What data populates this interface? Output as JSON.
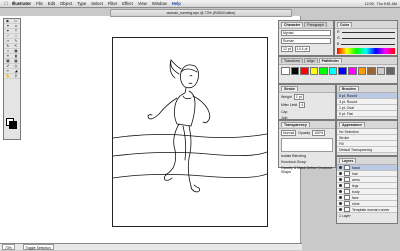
{
  "menubar": {
    "items": [
      "Illustrator",
      "File",
      "Edit",
      "Object",
      "Type",
      "Select",
      "Filter",
      "Effect",
      "View",
      "Window",
      "Help"
    ],
    "right": [
      "12:09",
      "Thu 9:51 AM"
    ]
  },
  "document": {
    "title": "woman_running.eps @ 73% (RGB/Outline)"
  },
  "status": {
    "zoom": "73%",
    "mode": "Toggle Selection"
  },
  "panels": {
    "character": {
      "tabs": [
        "Character",
        "Paragraph",
        "OpenType"
      ],
      "font": "Myriad",
      "style": "Roman",
      "size": "12 pt",
      "leading": "14.4 pt"
    },
    "color": {
      "tabs": [
        "Color"
      ],
      "labels": [
        "R",
        "G",
        "B"
      ]
    },
    "swatches": {
      "tabs": [
        "Transform",
        "Align",
        "Pathfinder"
      ],
      "colors": [
        "#ffffff",
        "#000000",
        "#ff0000",
        "#ffff00",
        "#00ff00",
        "#00ffff",
        "#0000ff",
        "#ff00ff",
        "#ff9900",
        "#996633",
        "#cccccc",
        "#666666"
      ]
    },
    "stroke": {
      "tabs": [
        "Stroke"
      ],
      "labels": [
        "Weight",
        "Miter Limit",
        "Cap",
        "Join"
      ],
      "weight": "1 pt",
      "miter": "4"
    },
    "brushes": {
      "tabs": [
        "Brushes"
      ],
      "items": [
        "5 pt. Round",
        "3 pt. Round",
        "1 pt. Oval",
        "5 pt. Flat"
      ]
    },
    "transparency": {
      "tabs": [
        "Transparency"
      ],
      "mode": "Normal",
      "opacity_label": "Opacity",
      "opacity": "100%",
      "checks": [
        "Isolate Blending",
        "Knockout Group",
        "Opacity & Mask Define Knockout Shape"
      ]
    },
    "appearance": {
      "tabs": [
        "Appearance"
      ],
      "items": [
        "No Selection",
        "Stroke",
        "Fill",
        "Default Transparency"
      ]
    },
    "layers": {
      "tabs": [
        "Layers"
      ],
      "items": [
        "hand",
        "hair",
        "arms",
        "legs",
        "body",
        "face",
        "shoe",
        "Template woman runner"
      ],
      "footer": "1 Layer"
    }
  }
}
